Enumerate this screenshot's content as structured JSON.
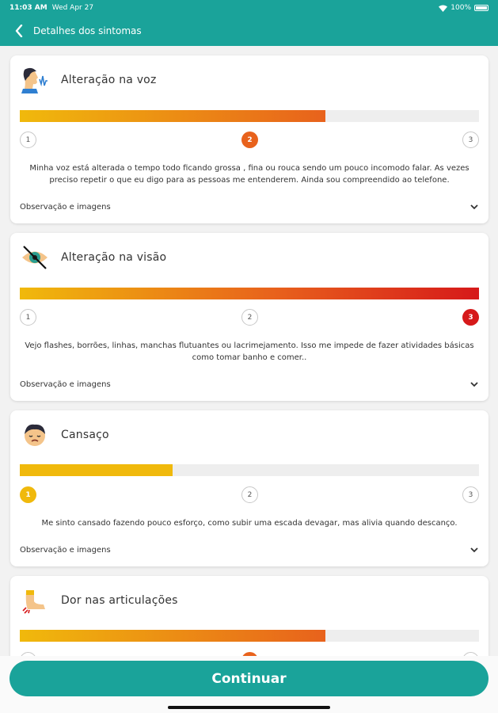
{
  "status_bar": {
    "time": "11:03 AM",
    "date": "Wed Apr 27",
    "battery": "100%"
  },
  "header": {
    "title": "Detalhes dos sintomas"
  },
  "symptoms": [
    {
      "name": "Alteração na voz",
      "icon": "voice-change-icon",
      "level": 2,
      "levels": [
        "1",
        "2",
        "3"
      ],
      "fill_fraction": 0.667,
      "active_color": "#e8621c",
      "description": "Minha voz está alterada o tempo todo ficando grossa , fina ou rouca sendo um pouco incomodo falar. As vezes preciso repetir o que eu digo para as pessoas me entenderem. Ainda sou compreendido ao telefone.",
      "observation": "Observação e imagens"
    },
    {
      "name": "Alteração na visão",
      "icon": "vision-change-icon",
      "level": 3,
      "levels": [
        "1",
        "2",
        "3"
      ],
      "fill_fraction": 1.0,
      "active_color": "#d6191a",
      "description": "Vejo flashes, borrões, linhas, manchas flutuantes ou lacrimejamento. Isso me impede de fazer atividades básicas como tomar banho e comer..",
      "observation": "Observação e imagens"
    },
    {
      "name": "Cansaço",
      "icon": "fatigue-icon",
      "level": 1,
      "levels": [
        "1",
        "2",
        "3"
      ],
      "fill_fraction": 0.333,
      "active_color": "#f0b90c",
      "description": "Me sinto cansado fazendo pouco esforço, como subir uma escada devagar, mas alivia quando descanço.",
      "observation": "Observação e imagens"
    },
    {
      "name": "Dor nas articulações",
      "icon": "joint-pain-icon",
      "level": 2,
      "levels": [
        "1",
        "2",
        "3"
      ],
      "fill_fraction": 0.667,
      "active_color": "#e8621c"
    }
  ],
  "footer": {
    "continue_label": "Continuar"
  },
  "colors": {
    "primary": "#1aa39a",
    "gradient_start": "#f0b90c",
    "gradient_mid": "#e8621c",
    "gradient_end": "#d6191a"
  }
}
